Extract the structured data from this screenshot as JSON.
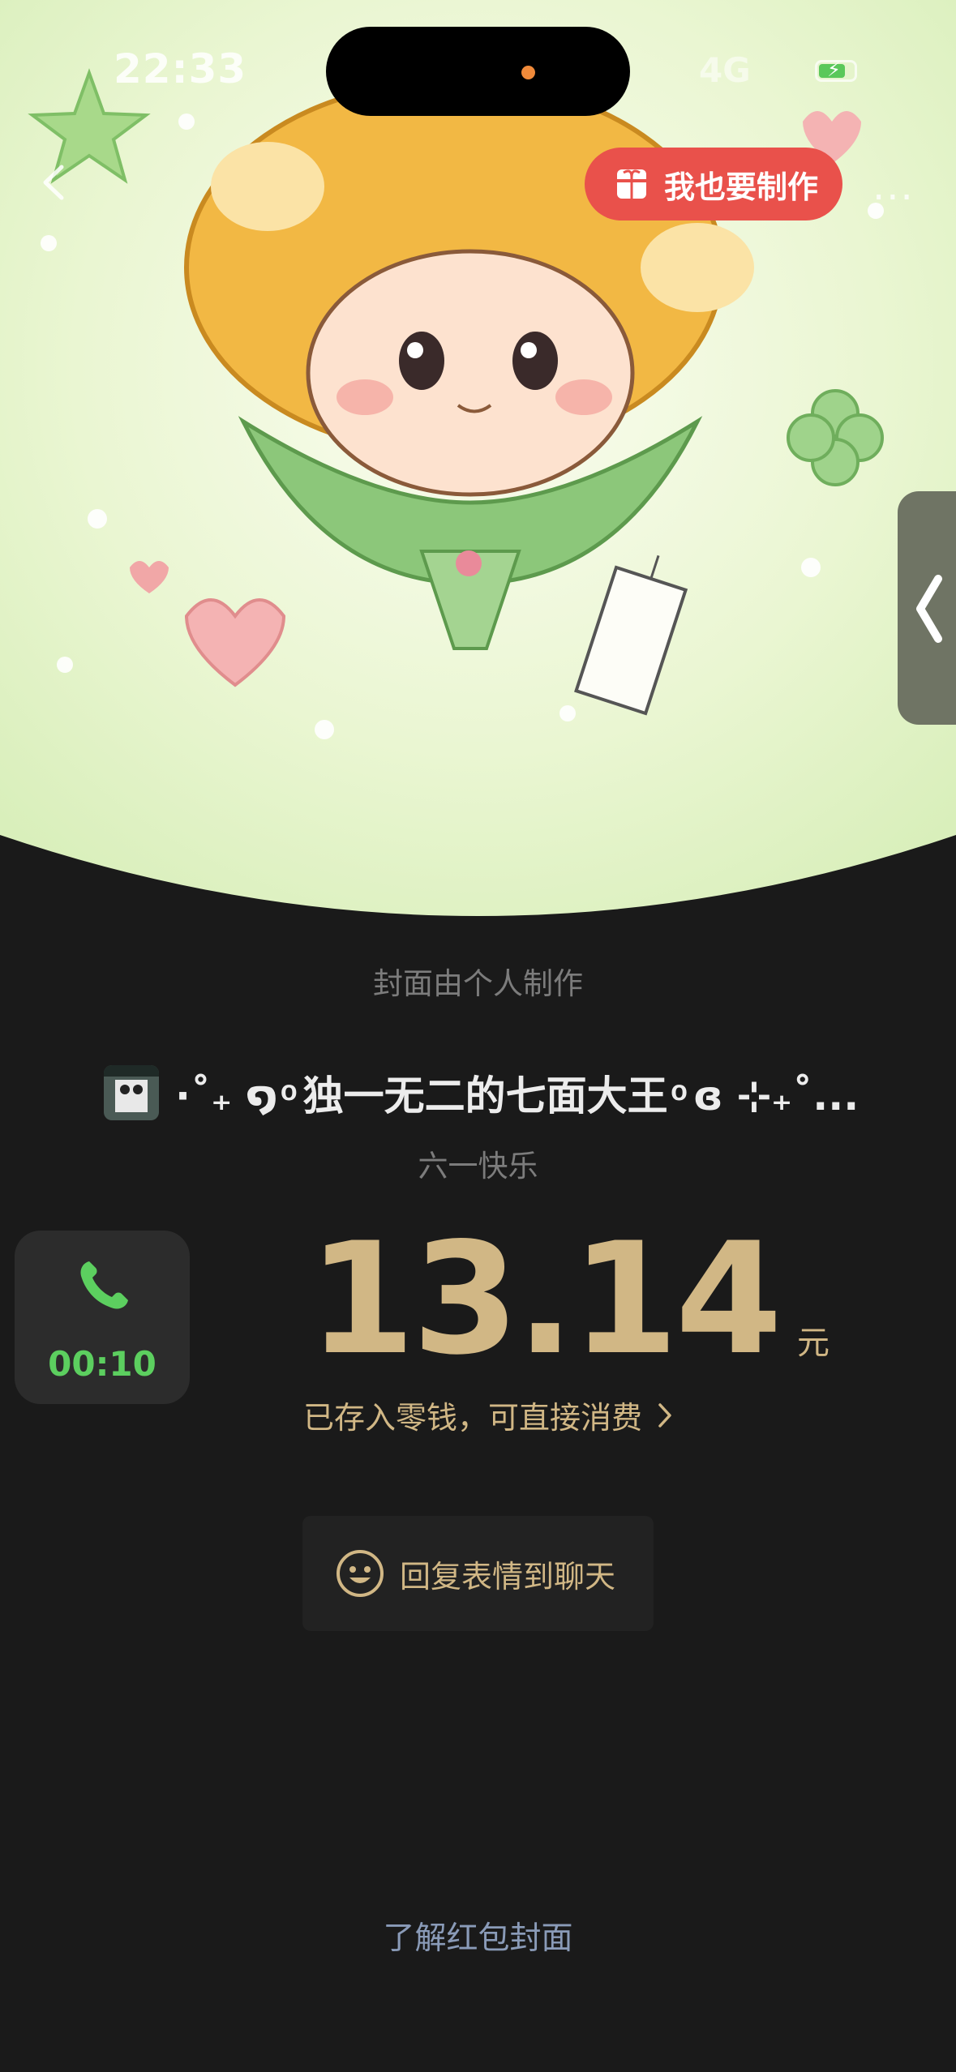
{
  "status_bar": {
    "time": "22:33",
    "signal_label": "4G"
  },
  "cover": {
    "make_button_label": "我也要制作",
    "note": "封面由个人制作"
  },
  "sender": {
    "name": "·˚₊ ໑ ͦ 独一无二的七面大王 ͦ ɞ ⊹₊˚..."
  },
  "wish": "六一快乐",
  "call_widget": {
    "duration": "00:10"
  },
  "amount": {
    "value": "13.14",
    "unit": "元"
  },
  "saved_note": "已存入零钱，可直接消费",
  "reply_button_label": "回复表情到聊天",
  "learn_link": "了解红包封面",
  "colors": {
    "gold": "#d1b785",
    "red": "#e9514b",
    "green": "#5ccf5f",
    "bg": "#1a1a1a"
  }
}
